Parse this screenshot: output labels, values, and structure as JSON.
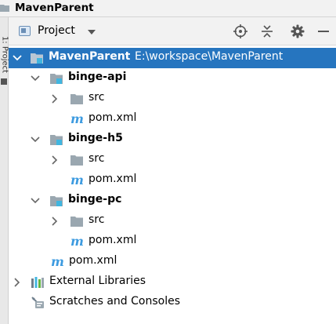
{
  "topbar": {
    "title": "MavenParent"
  },
  "strip": {
    "label": "1: Project"
  },
  "header": {
    "view_label": "Project",
    "buttons": [
      "locate-icon",
      "collapse-all-icon",
      "gear-icon",
      "minimize-icon"
    ]
  },
  "tree": {
    "root": {
      "name": "MavenParent",
      "path": "E:\\workspace\\MavenParent"
    },
    "modules": [
      {
        "name": "binge-api",
        "src": "src",
        "pom": "pom.xml"
      },
      {
        "name": "binge-h5",
        "src": "src",
        "pom": "pom.xml"
      },
      {
        "name": "binge-pc",
        "src": "src",
        "pom": "pom.xml"
      }
    ],
    "root_pom": "pom.xml",
    "external_libraries": "External Libraries",
    "scratches": "Scratches and Consoles"
  },
  "colors": {
    "selection": "#2675bf",
    "folder": "#9aa7b0",
    "module_badge": "#40b6e0",
    "maven": "#3d9be0"
  }
}
